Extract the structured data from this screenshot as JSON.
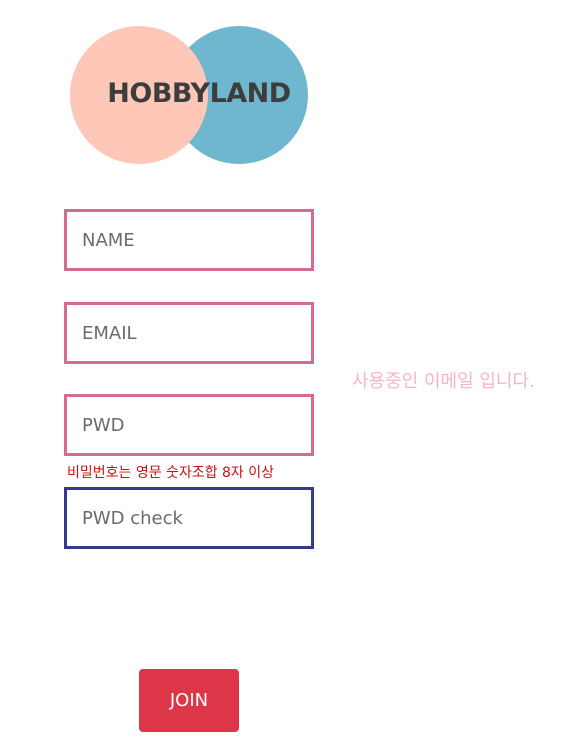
{
  "logo": {
    "text": "HOBBYLAND",
    "colors": {
      "left_circle": "#ffc7b7",
      "right_circle": "#6fb6cf",
      "text": "#3d3d3d"
    }
  },
  "form": {
    "name_placeholder": "NAME",
    "email_placeholder": "EMAIL",
    "pwd_placeholder": "PWD",
    "pwd_check_placeholder": "PWD check",
    "email_message": "사용중인 이메일 입니다.",
    "pwd_hint": "비밀번호는 영문 숫자조합 8자 이상",
    "join_label": "JOIN"
  },
  "colors": {
    "field_border": "#d36b92",
    "field_focus_border": "#363a8c",
    "email_message": "#f7b6c6",
    "pwd_hint": "#cc1010",
    "join_button": "#de3649"
  }
}
